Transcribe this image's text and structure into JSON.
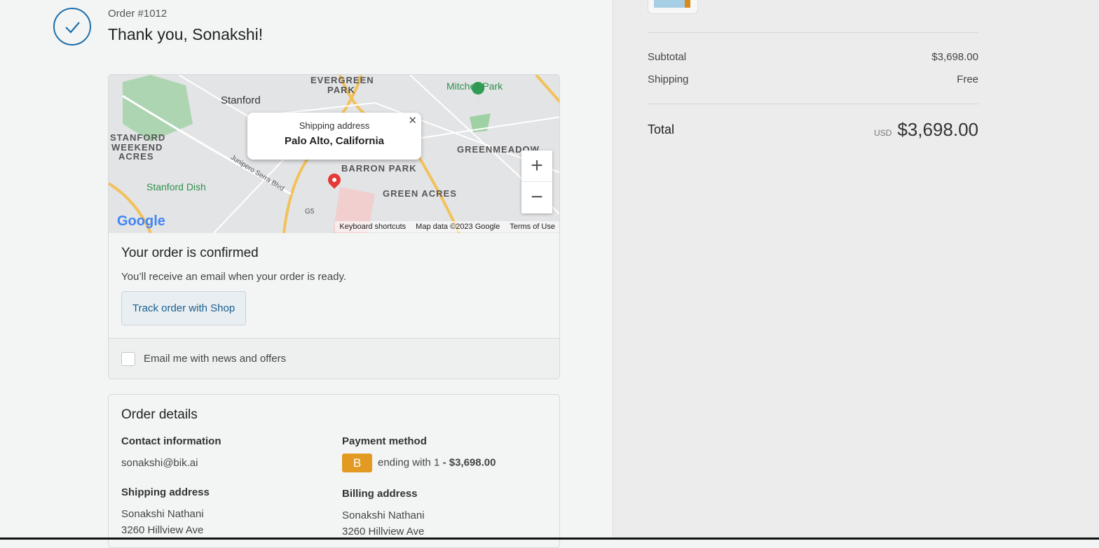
{
  "header": {
    "order_number": "Order #1012",
    "thank_you": "Thank you, Sonakshi!"
  },
  "map": {
    "popup_title": "Shipping address",
    "popup_location": "Palo Alto, California",
    "labels": {
      "evergreen": "EVERGREEN",
      "park": "PARK",
      "stanford": "Stanford",
      "mitchell": "Mitchell Park",
      "swa1": "STANFORD",
      "swa2": "WEEKEND",
      "swa3": "ACRES",
      "greenmeadow": "GREENMEADOW",
      "barron": "BARRON PARK",
      "green_acres": "GREEN ACRES",
      "dish": "Stanford Dish",
      "junipero": "Junipero Serra Blvd",
      "g5": "G5"
    },
    "google": "Google",
    "keyboard": "Keyboard shortcuts",
    "mapdata": "Map data ©2023 Google",
    "terms": "Terms of Use",
    "zoom_in": "+",
    "zoom_out": "−",
    "close": "✕"
  },
  "confirmed": {
    "title": "Your order is confirmed",
    "message": "You’ll receive an email when your order is ready.",
    "track_button": "Track order with Shop",
    "optin_label": "Email me with news and offers"
  },
  "details": {
    "title": "Order details",
    "contact_label": "Contact information",
    "contact_value": "sonakshi@bik.ai",
    "payment_label": "Payment method",
    "payment_badge": "B",
    "payment_text": "ending with 1",
    "payment_amount": "- $3,698.00",
    "shipping_label": "Shipping address",
    "shipping_name": "Sonakshi Nathani",
    "shipping_street": "3260 Hillview Ave",
    "billing_label": "Billing address",
    "billing_name": "Sonakshi Nathani",
    "billing_street": "3260 Hillview Ave"
  },
  "summary": {
    "subtotal_label": "Subtotal",
    "subtotal_value": "$3,698.00",
    "shipping_label": "Shipping",
    "shipping_value": "Free",
    "total_label": "Total",
    "currency": "USD",
    "total_value": "$3,698.00"
  },
  "colors": {
    "accent": "#1f6fa8",
    "badge": "#e29a22"
  }
}
